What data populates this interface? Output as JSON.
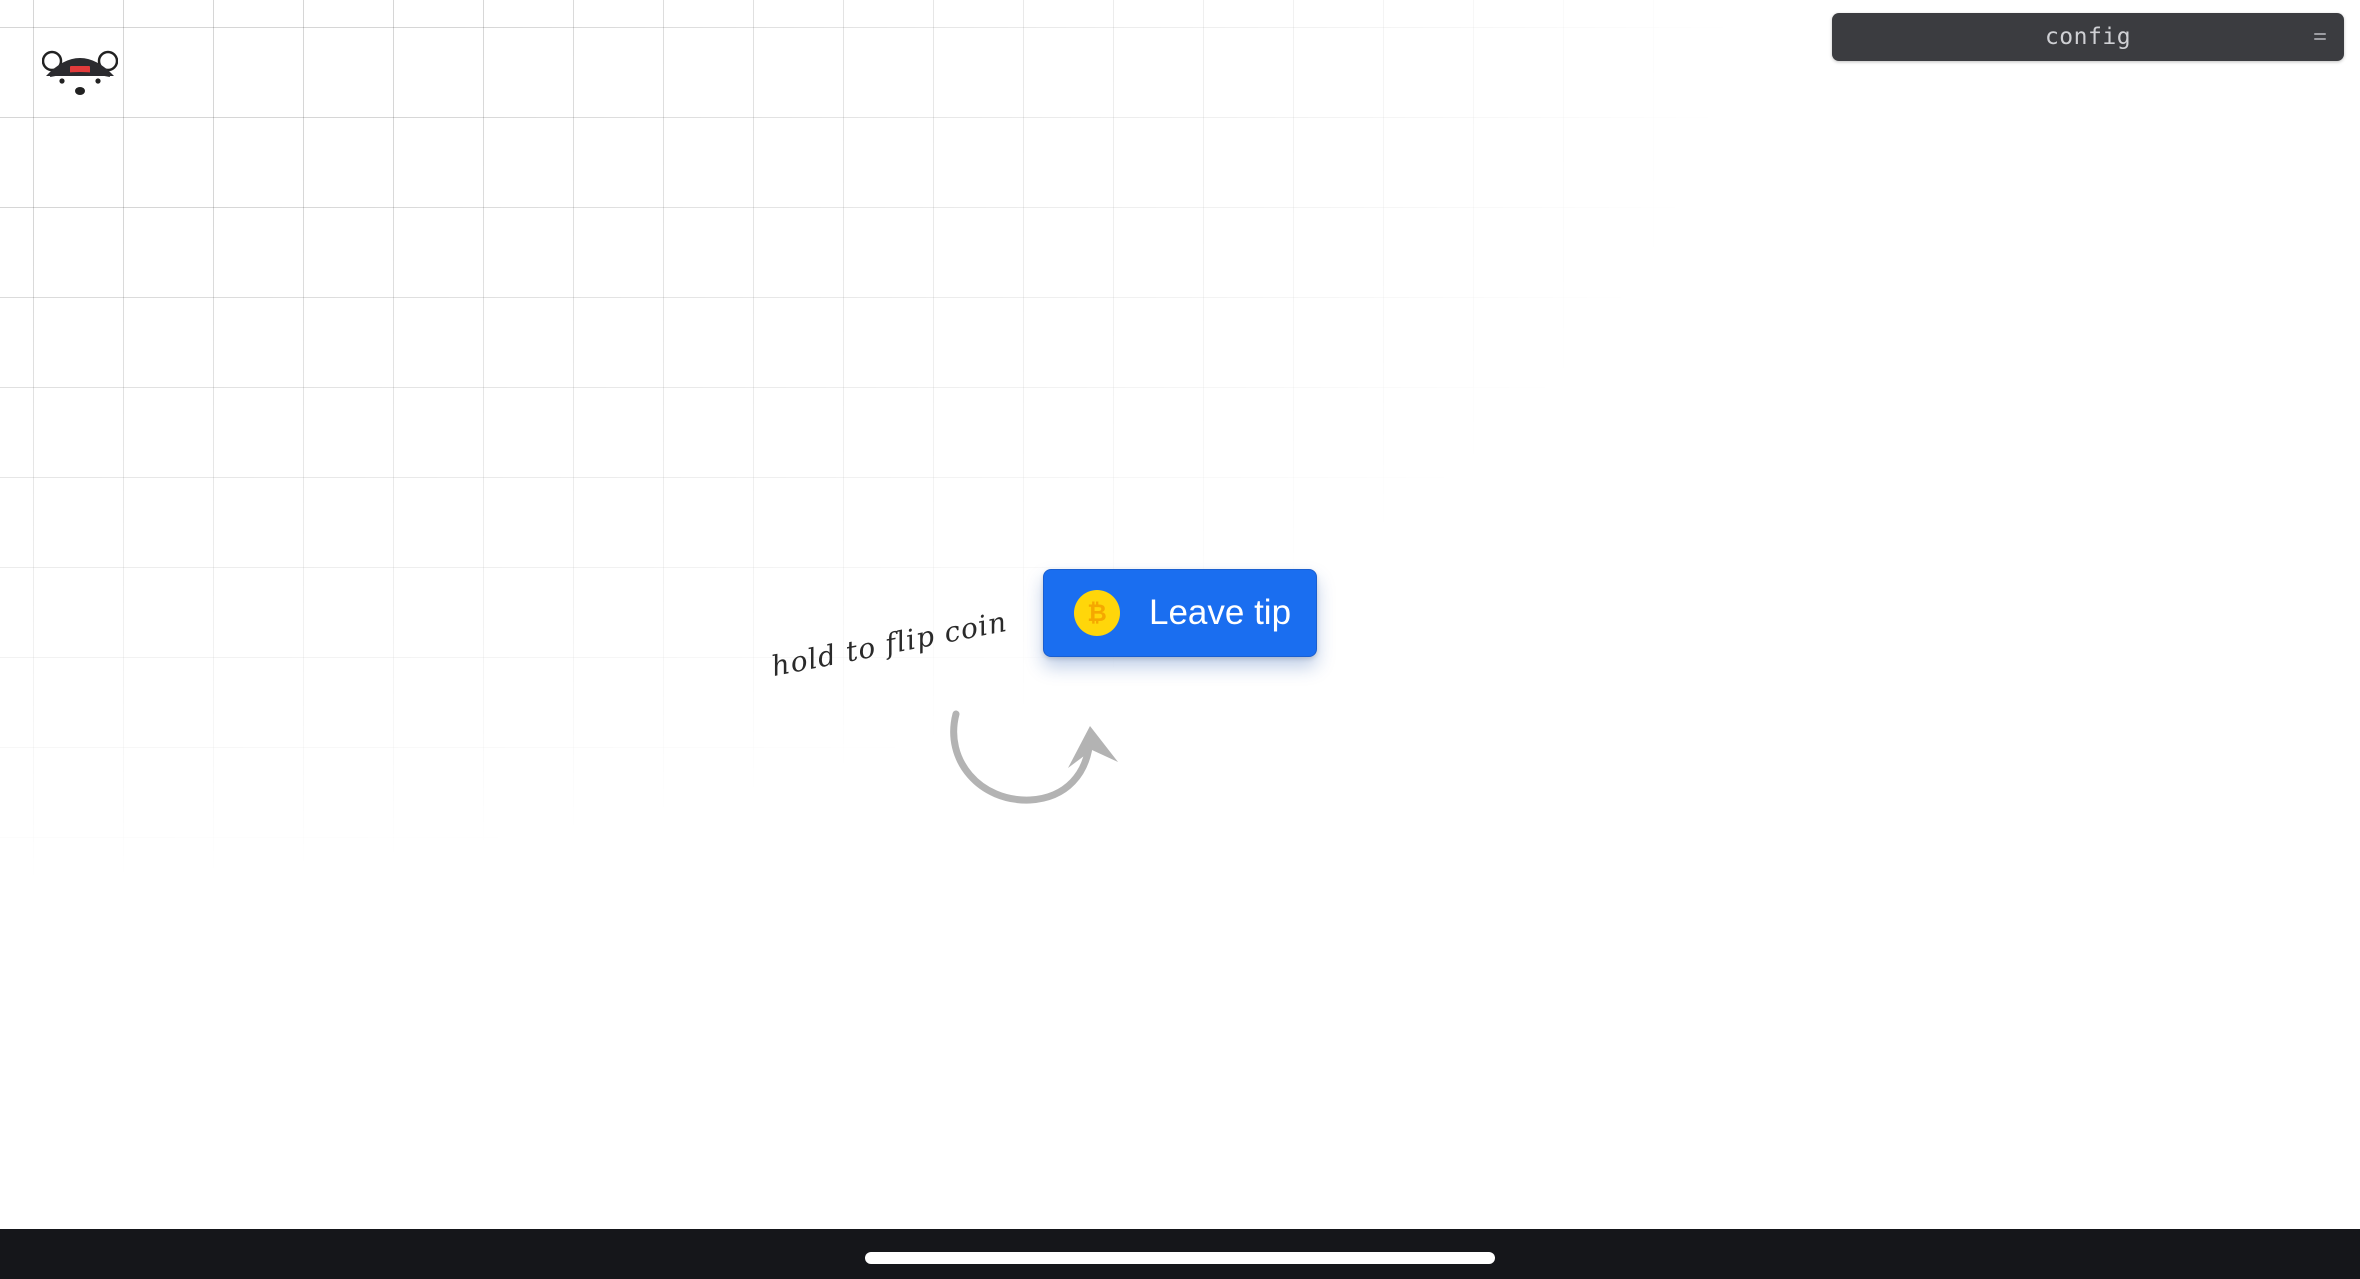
{
  "config": {
    "title": "config",
    "toggle_icon": "collapse-icon"
  },
  "tip_button": {
    "label": "Leave tip",
    "coin_icon": "bitcoin-icon",
    "coin_glyph": "₿",
    "background_color": "#1a6ef0",
    "coin_color": "#ffd60a"
  },
  "hint": {
    "text": "hold to flip coin",
    "arrow_icon": "curved-arrow-icon"
  },
  "logo": {
    "icon": "bear-logo-icon"
  },
  "system": {
    "home_indicator": "home-indicator"
  }
}
